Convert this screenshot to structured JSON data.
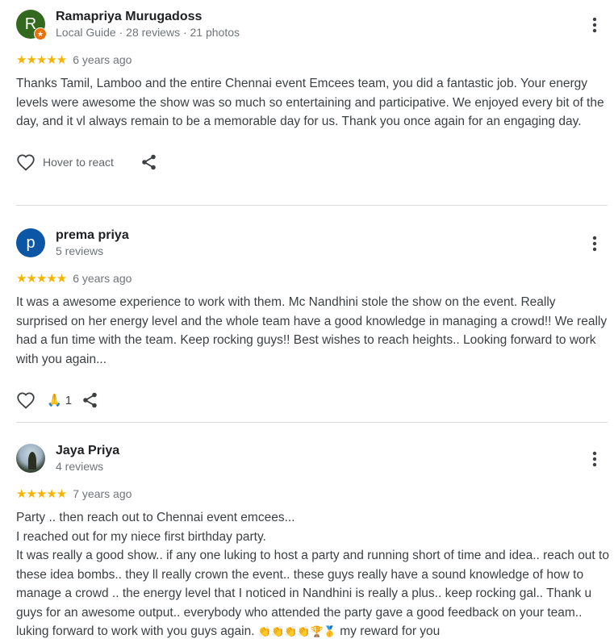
{
  "reviews": [
    {
      "avatar_letter": "R",
      "avatar_color": "#33691e",
      "name": "Ramapriya Murugadoss",
      "meta": "Local Guide · 28 reviews · 21 photos",
      "stars": "★★★★★",
      "rating": 5,
      "age": "6 years ago",
      "text": "Thanks Tamil, Lamboo and the entire Chennai event Emcees team, you did a fantastic job. Your energy levels were awesome the show was so much so entertaining and participative. We enjoyed every bit of the day, and it vl always remain to be a memorable day for us. Thank you once again for an engaging day.",
      "react_label": "Hover to react"
    },
    {
      "avatar_letter": "p",
      "avatar_color": "#0b57a5",
      "name": "prema priya",
      "meta": "5 reviews",
      "stars": "★★★★★",
      "rating": 5,
      "age": "6 years ago",
      "text": "It was a awesome experience to work with them. Mc Nandhini stole the show on the event. Really surprised on her energy level and the whole team have a good knowledge in managing a crowd!! We really had a fun time with the team. Keep rocking guys!! Best wishes to reach heights.. Looking forward to work with you again...",
      "reaction_emoji": "🙏",
      "reaction_count": "1"
    },
    {
      "name": "Jaya Priya",
      "meta": "4 reviews",
      "stars": "★★★★★",
      "rating": 5,
      "age": "7 years ago",
      "text": "Party .. then reach out to Chennai event emcees...\nI reached out for my niece first birthday party.\nIt was really a good show.. if any one luking to host a party and running short of time and idea.. reach out to these idea bombs.. they ll really crown the event.. these guys really have a sound knowledge of how to manage a crowd .. the energy level that I noticed in Nandhini is really a plus.. keep rocking gal.. Thank u guys for an awesome output.. everybody who attended the party gave a good feedback on your team.. luking forward to work with you guys again. ",
      "text_emoji": "👏👏👏👏🏆🥇",
      "text_tail": " my reward for you"
    }
  ],
  "icons": {
    "more": "more-vert-icon",
    "heart": "heart-outline-icon",
    "share": "share-icon",
    "badge": "local-guide-star-icon"
  },
  "colors": {
    "star": "#f4b400",
    "divider": "#dadce0",
    "secondary_text": "#70757a"
  }
}
